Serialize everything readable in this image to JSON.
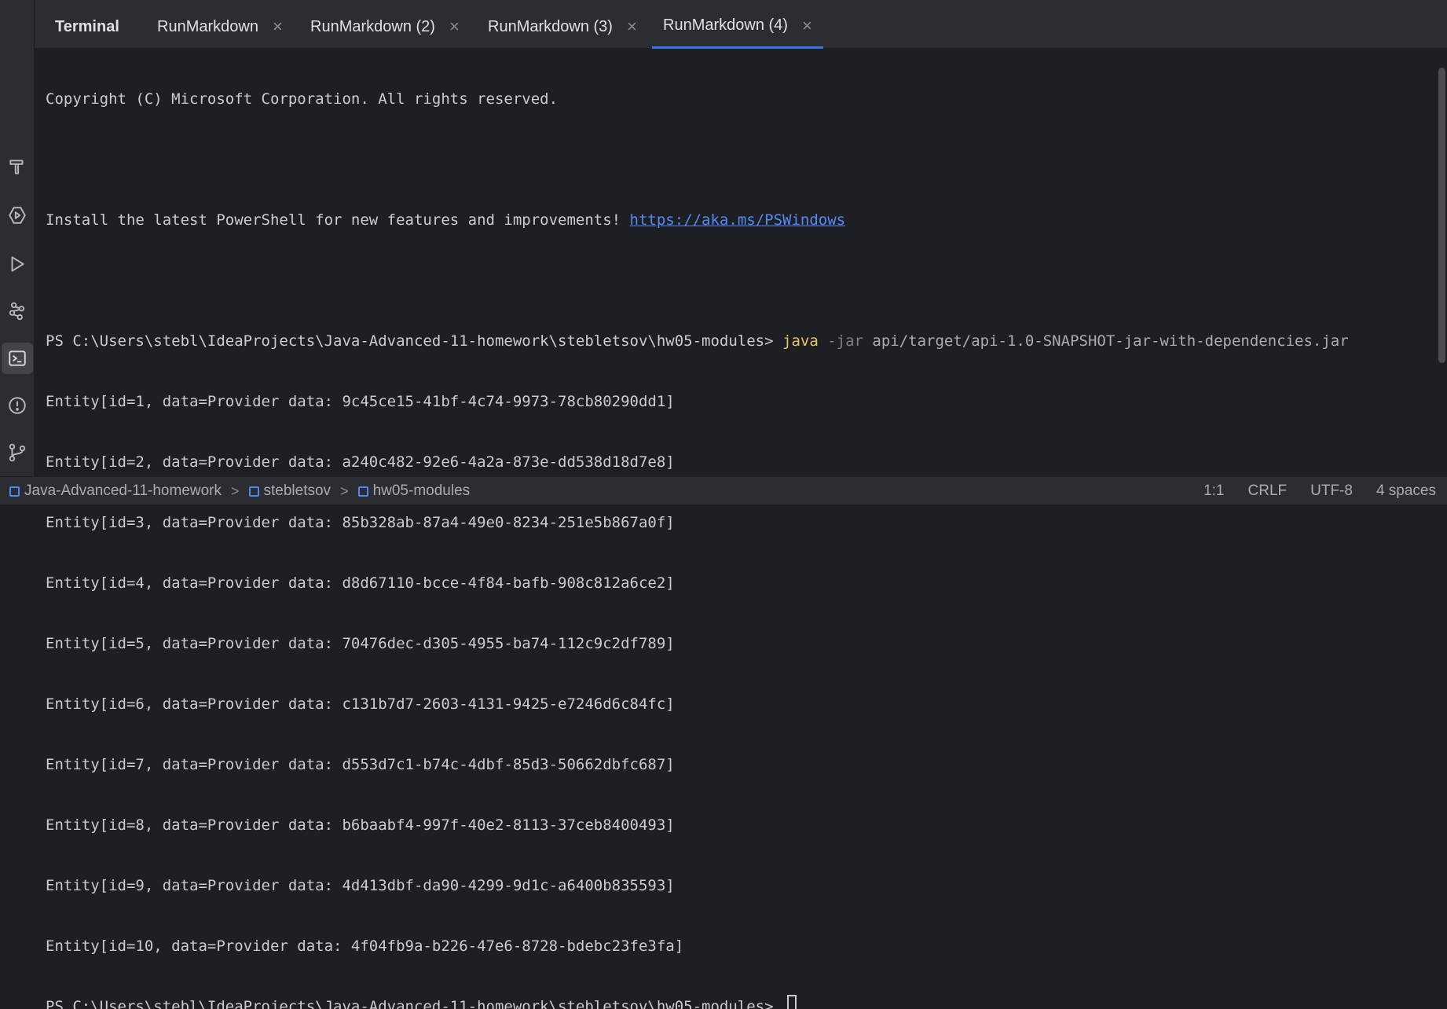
{
  "tool_window": {
    "title": "Terminal"
  },
  "tabs": [
    {
      "label": "RunMarkdown",
      "active": false
    },
    {
      "label": "RunMarkdown (2)",
      "active": false
    },
    {
      "label": "RunMarkdown (3)",
      "active": false
    },
    {
      "label": "RunMarkdown (4)",
      "active": true
    }
  ],
  "tab_close_glyph": "×",
  "left_toolbar": {
    "icons": [
      "build-hammer-icon",
      "services-icon",
      "run-icon",
      "dependencies-icon",
      "terminal-icon",
      "problems-icon",
      "git-icon"
    ],
    "active": "terminal-icon"
  },
  "terminal": {
    "copyright": "Copyright (C) Microsoft Corporation. All rights reserved.",
    "install_text": "Install the latest PowerShell for new features and improvements! ",
    "install_link": "https://aka.ms/PSWindows",
    "prompt": "PS C:\\Users\\stebl\\IdeaProjects\\Java-Advanced-11-homework\\stebletsov\\hw05-modules> ",
    "command": {
      "exe": "java",
      "flag": " -jar",
      "arg": " api/target/api-1.0-SNAPSHOT-jar-with-dependencies.jar"
    },
    "output": [
      "Entity[id=1, data=Provider data: 9c45ce15-41bf-4c74-9973-78cb80290dd1]",
      "Entity[id=2, data=Provider data: a240c482-92e6-4a2a-873e-dd538d18d7e8]",
      "Entity[id=3, data=Provider data: 85b328ab-87a4-49e0-8234-251e5b867a0f]",
      "Entity[id=4, data=Provider data: d8d67110-bcce-4f84-bafb-908c812a6ce2]",
      "Entity[id=5, data=Provider data: 70476dec-d305-4955-ba74-112c9c2df789]",
      "Entity[id=6, data=Provider data: c131b7d7-2603-4131-9425-e7246d6c84fc]",
      "Entity[id=7, data=Provider data: d553d7c1-b74c-4dbf-85d3-50662dbfc687]",
      "Entity[id=8, data=Provider data: b6baabf4-997f-40e2-8113-37ceb8400493]",
      "Entity[id=9, data=Provider data: 4d413dbf-da90-4299-9d1c-a6400b835593]",
      "Entity[id=10, data=Provider data: 4f04fb9a-b226-47e6-8728-bdebc23fe3fa]"
    ]
  },
  "statusbar": {
    "breadcrumb": [
      "Java-Advanced-11-homework",
      "stebletsov",
      "hw05-modules"
    ],
    "breadcrumb_separator": ">",
    "position": "1:1",
    "line_separator": "CRLF",
    "encoding": "UTF-8",
    "indent": "4 spaces"
  },
  "colors": {
    "background": "#1e1f22",
    "panel": "#2b2d30",
    "accent": "#3574f0",
    "link": "#548af7",
    "command_keyword": "#e8c46a"
  }
}
